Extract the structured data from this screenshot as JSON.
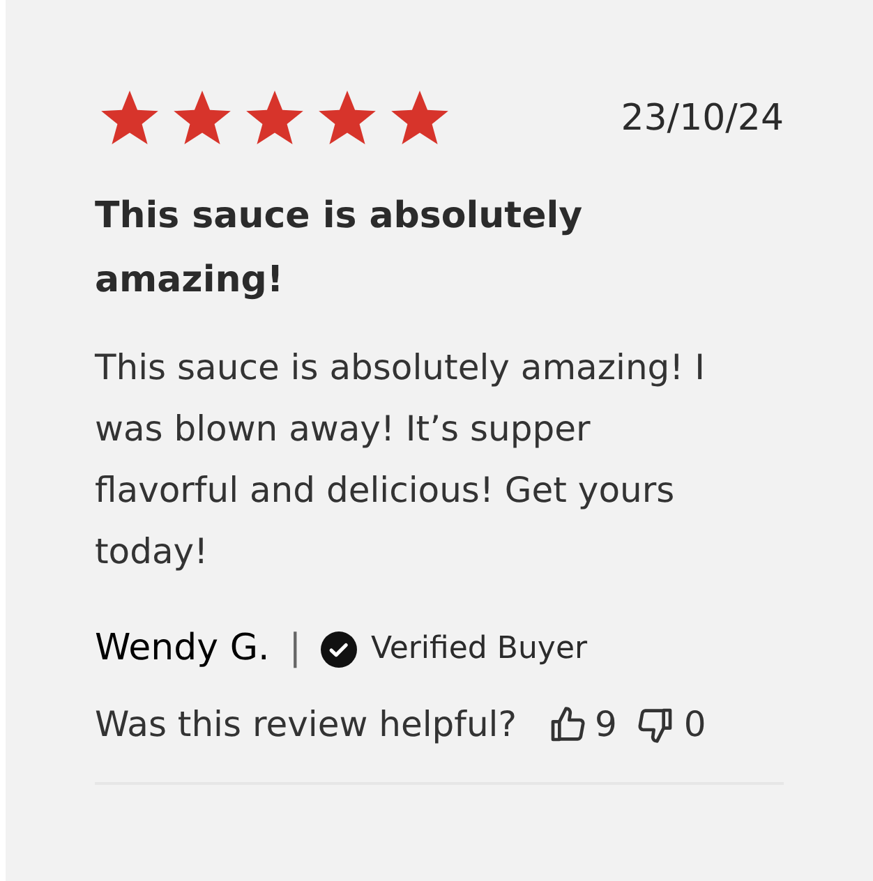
{
  "review": {
    "stars": 5,
    "date": "23/10/24",
    "title": "This sauce is absolutely amazing!",
    "body": "This sauce is absolutely amazing! I was blown away! It’s supper flavorful and delicious! Get yours today!",
    "author": "Wendy G.",
    "separator": "|",
    "badge": "Verified Buyer",
    "helpful_prompt": "Was this review helpful?",
    "upvotes": "9",
    "downvotes": "0"
  }
}
